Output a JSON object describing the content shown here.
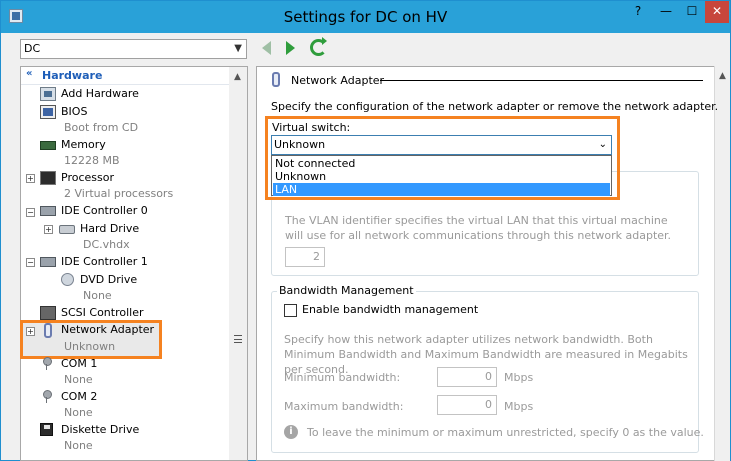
{
  "window": {
    "title": "Settings for DC on HV",
    "controls": {
      "help": "?",
      "minimize": "—",
      "maximize": "☐",
      "close": "✕"
    }
  },
  "vm_selector": {
    "value": "DC"
  },
  "tree": {
    "section_header": "Hardware",
    "items": [
      {
        "label": "Add Hardware",
        "sub": ""
      },
      {
        "label": "BIOS",
        "sub": "Boot from CD"
      },
      {
        "label": "Memory",
        "sub": "12228 MB"
      },
      {
        "label": "Processor",
        "sub": "2 Virtual processors"
      },
      {
        "label": "IDE Controller 0",
        "sub": ""
      },
      {
        "label": "Hard Drive",
        "sub": "DC.vhdx"
      },
      {
        "label": "IDE Controller 1",
        "sub": ""
      },
      {
        "label": "DVD Drive",
        "sub": "None"
      },
      {
        "label": "SCSI Controller",
        "sub": ""
      },
      {
        "label": "Network Adapter",
        "sub": "Unknown"
      },
      {
        "label": "COM 1",
        "sub": "None"
      },
      {
        "label": "COM 2",
        "sub": "None"
      },
      {
        "label": "Diskette Drive",
        "sub": "None"
      }
    ]
  },
  "panel": {
    "section_title": "Network Adapter",
    "description": "Specify the configuration of the network adapter or remove the network adapter.",
    "virtual_switch": {
      "label": "Virtual switch:",
      "selected": "Unknown",
      "options": [
        "Not connected",
        "Unknown",
        "LAN"
      ],
      "highlighted": "LAN"
    },
    "vlan": {
      "description": "The VLAN identifier specifies the virtual LAN that this virtual machine will use for all network communications through this network adapter.",
      "value": "2"
    },
    "bandwidth": {
      "title": "Bandwidth Management",
      "checkbox_label": "Enable bandwidth management",
      "description": "Specify how this network adapter utilizes network bandwidth. Both Minimum Bandwidth and Maximum Bandwidth are measured in Megabits per second.",
      "min_label": "Minimum bandwidth:",
      "min_value": "0",
      "max_label": "Maximum bandwidth:",
      "max_value": "0",
      "unit": "Mbps",
      "info": "To leave the minimum or maximum unrestricted, specify 0 as the value."
    }
  },
  "colors": {
    "highlight_border": "#f58220",
    "title_bar": "#29a1d8",
    "tree_header": "#1e5eb8",
    "list_selection": "#3399ff"
  }
}
